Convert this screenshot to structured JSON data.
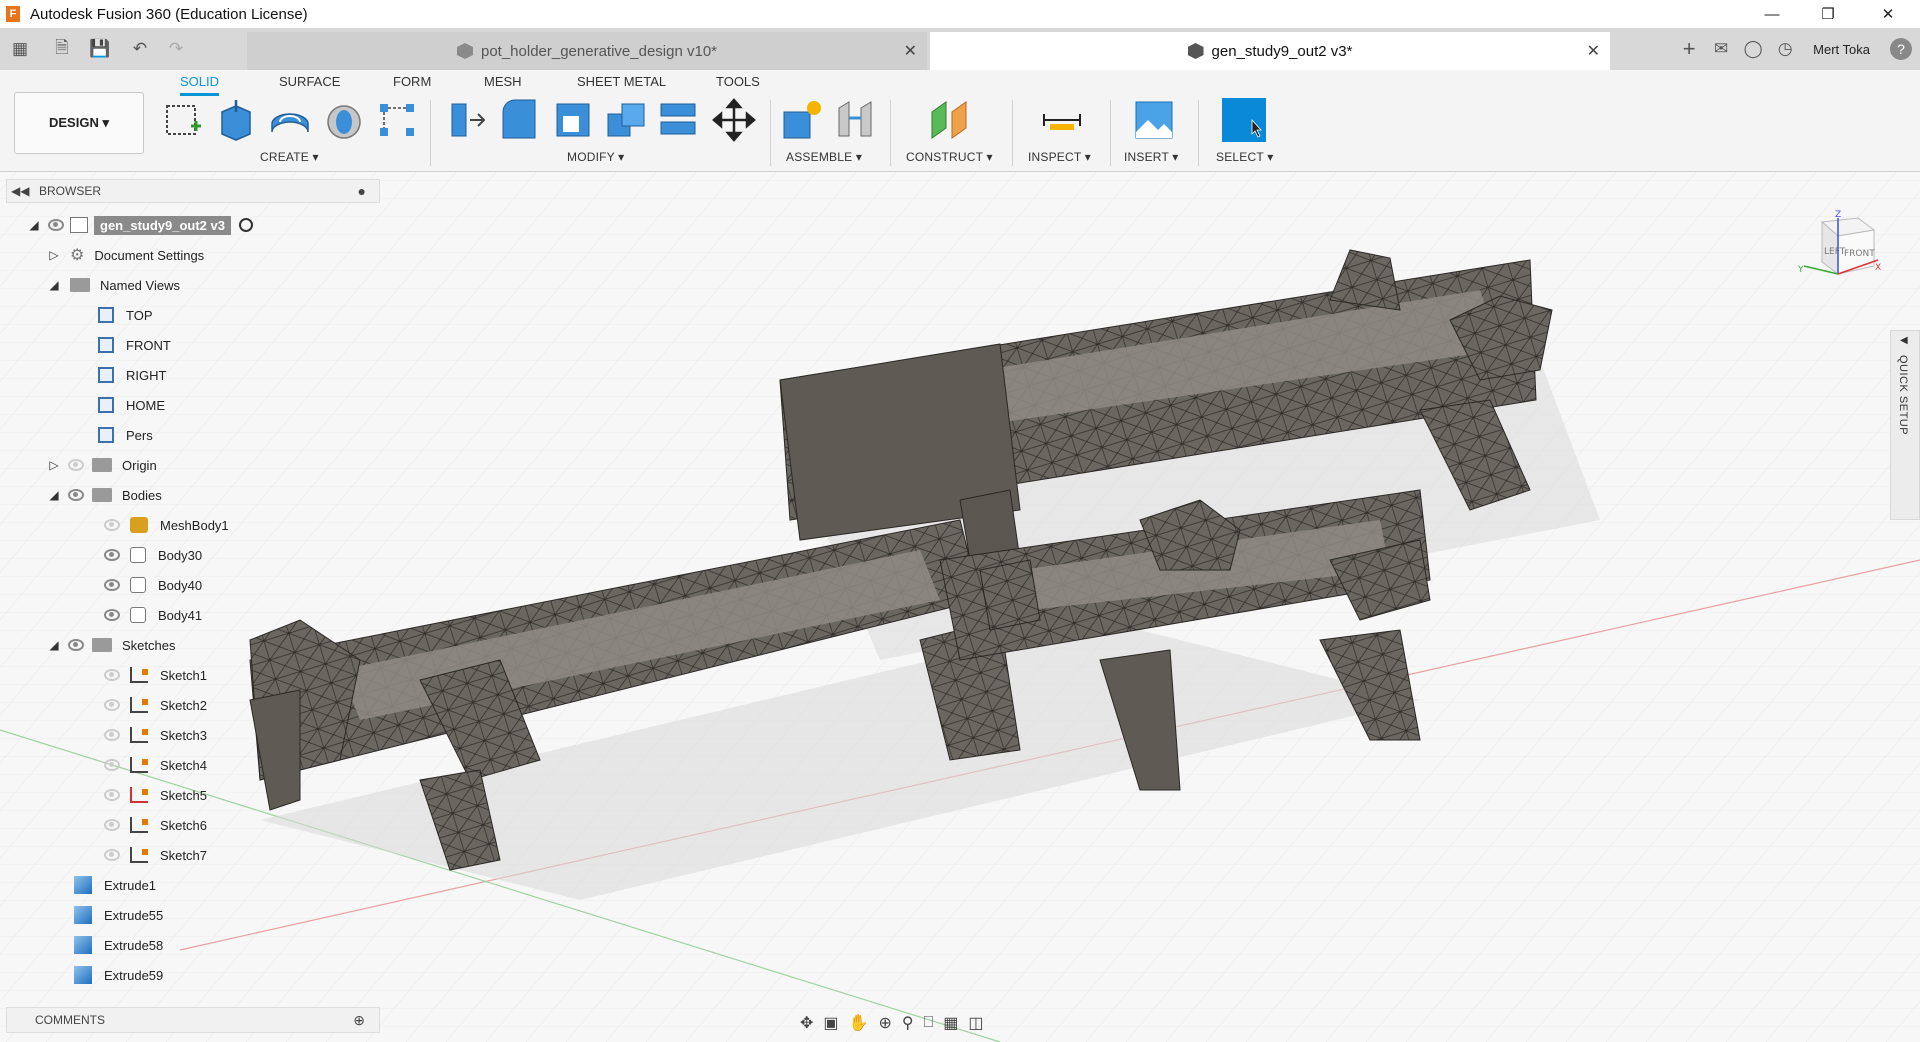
{
  "window": {
    "title": "Autodesk Fusion 360 (Education License)",
    "logo_letter": "F"
  },
  "tabs": [
    {
      "label": "pot_holder_generative_design v10*",
      "active": false
    },
    {
      "label": "gen_study9_out2 v3*",
      "active": true
    }
  ],
  "user": {
    "name": "Mert Toka"
  },
  "ribbon": {
    "workspace": "DESIGN ▾",
    "tabs": [
      "SOLID",
      "SURFACE",
      "FORM",
      "MESH",
      "SHEET METAL",
      "TOOLS"
    ],
    "groups": [
      "CREATE ▾",
      "MODIFY ▾",
      "ASSEMBLE ▾",
      "CONSTRUCT ▾",
      "INSPECT ▾",
      "INSERT ▾",
      "SELECT ▾"
    ]
  },
  "browser": {
    "header": "BROWSER",
    "root": "gen_study9_out2 v3",
    "items": [
      {
        "label": "Document Settings"
      },
      {
        "label": "Named Views"
      },
      {
        "label": "TOP"
      },
      {
        "label": "FRONT"
      },
      {
        "label": "RIGHT"
      },
      {
        "label": "HOME"
      },
      {
        "label": "Pers"
      },
      {
        "label": "Origin"
      },
      {
        "label": "Bodies"
      },
      {
        "label": "MeshBody1"
      },
      {
        "label": "Body30"
      },
      {
        "label": "Body40"
      },
      {
        "label": "Body41"
      },
      {
        "label": "Sketches"
      },
      {
        "label": "Sketch1"
      },
      {
        "label": "Sketch2"
      },
      {
        "label": "Sketch3"
      },
      {
        "label": "Sketch4"
      },
      {
        "label": "Sketch5"
      },
      {
        "label": "Sketch6"
      },
      {
        "label": "Sketch7"
      },
      {
        "label": "Extrude1"
      },
      {
        "label": "Extrude55"
      },
      {
        "label": "Extrude58"
      },
      {
        "label": "Extrude59"
      }
    ]
  },
  "comments": {
    "label": "COMMENTS"
  },
  "quick_setup": {
    "label": "QUICK SETUP"
  },
  "viewcube": {
    "left": "LEFT",
    "front": "FRONT",
    "z": "Z",
    "x": "X",
    "y": "Y"
  },
  "colors": {
    "accent": "#0696d7",
    "model": "#6a6760"
  }
}
